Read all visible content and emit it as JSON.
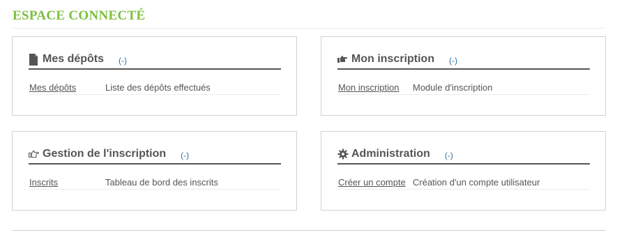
{
  "page": {
    "title": "ESPACE CONNECTÉ"
  },
  "panels": {
    "depots": {
      "title": "Mes dépôts",
      "toggle": "(-)",
      "icon": "document-icon",
      "row": {
        "link": "Mes dépôts",
        "desc": "Liste des dépôts effectués"
      }
    },
    "inscription": {
      "title": "Mon inscription",
      "toggle": "(-)",
      "icon": "hand-point-right-icon",
      "row": {
        "link": "Mon inscription",
        "desc": "Module d'inscription"
      }
    },
    "gestion": {
      "title": "Gestion de l'inscription",
      "toggle": "(-)",
      "icon": "hand-point-right-outline-icon",
      "row": {
        "link": "Inscrits",
        "desc": "Tableau de bord des inscrits"
      }
    },
    "admin": {
      "title": "Administration",
      "toggle": "(-)",
      "icon": "gear-icon",
      "row": {
        "link": "Créer un compte",
        "desc": "Création d'un compte utilisateur"
      }
    }
  },
  "colors": {
    "title_green": "#7cbf3f",
    "text": "#555555",
    "toggle_blue": "#2a6fa0",
    "border": "#d2d2d2"
  }
}
